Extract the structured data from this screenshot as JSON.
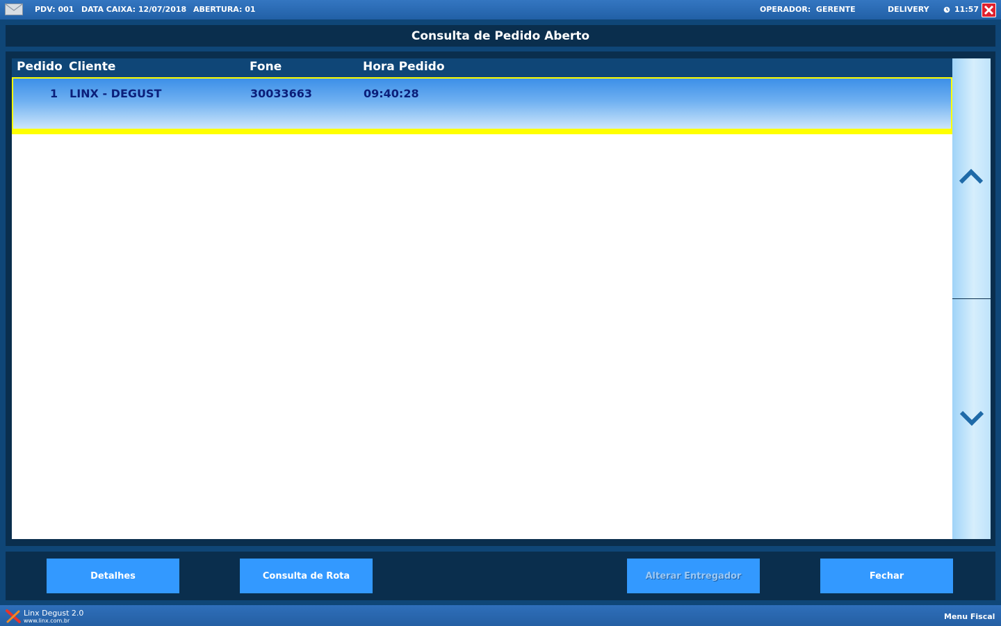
{
  "topbar": {
    "pdv": "PDV: 001",
    "data_caixa": "DATA CAIXA: 12/07/2018",
    "abertura": "ABERTURA: 01",
    "operador": "OPERADOR:  GERENTE",
    "mode": "DELIVERY",
    "time": "11:57",
    "icons": [
      "mail-icon",
      "clock-icon",
      "close-icon"
    ]
  },
  "page": {
    "title": "Consulta de Pedido Aberto"
  },
  "table": {
    "columns": [
      "Pedido",
      "Cliente",
      "Fone",
      "Hora Pedido"
    ],
    "rows": [
      {
        "pedido": "1",
        "cliente": "LINX - DEGUST",
        "fone": "30033663",
        "hora": "09:40:28"
      }
    ],
    "selected_row": 0
  },
  "scroll": {
    "up_icon": "chevron-up-icon",
    "down_icon": "chevron-down-icon"
  },
  "actions": {
    "detalhes": "Detalhes",
    "consulta_rota": "Consulta de Rota",
    "alterar_entregador": "Alterar Entregador",
    "fechar": "Fechar"
  },
  "footer": {
    "app_name": "Linx Degust 2.0",
    "site": "www.linx.com.br",
    "menu": "Menu Fiscal",
    "logo_icon": "linx-logo-icon"
  },
  "colors": {
    "background": "#0f4677",
    "panel": "#0a2e4d",
    "button": "#3399ff",
    "selection_border": "#ffff00",
    "row_text": "#0b1f7a",
    "close_red": "#e0212e"
  }
}
